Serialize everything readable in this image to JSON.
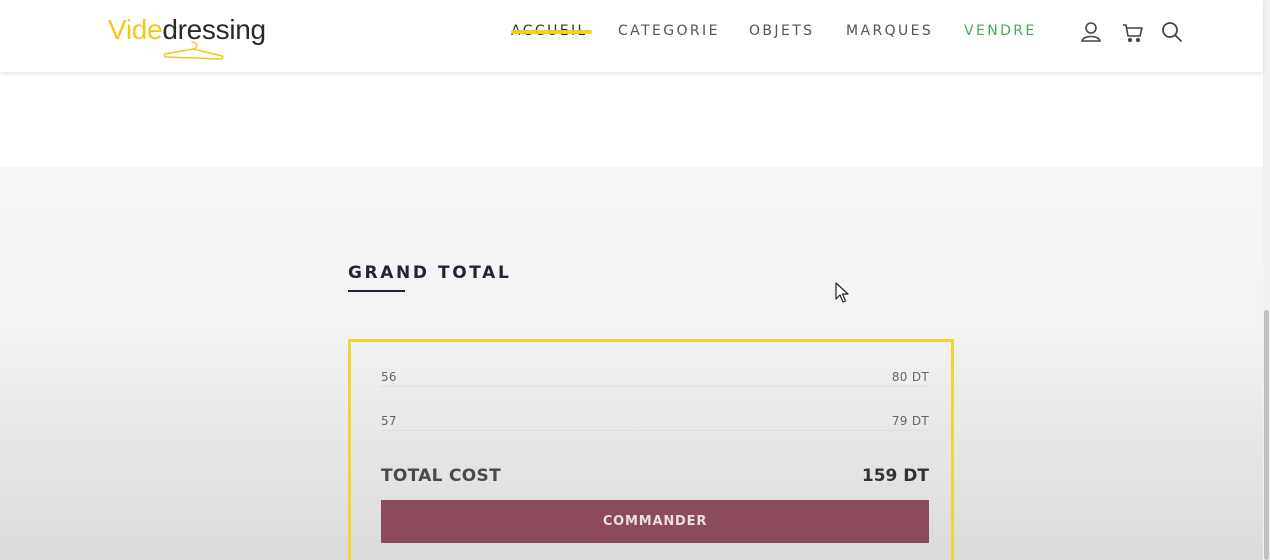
{
  "header": {
    "logo": {
      "part1": "Vide",
      "part2": "dressing"
    },
    "nav": [
      {
        "label": "ACCUEIL",
        "state": "active"
      },
      {
        "label": "CATEGORIE",
        "state": "default"
      },
      {
        "label": "OBJETS",
        "state": "default"
      },
      {
        "label": "MARQUES",
        "state": "default"
      },
      {
        "label": "VENDRE",
        "state": "highlight"
      }
    ],
    "icons": [
      "user-icon",
      "cart-icon",
      "search-icon"
    ]
  },
  "grand_total": {
    "title": "GRAND TOTAL",
    "items": [
      {
        "label": "56",
        "price": "80 DT"
      },
      {
        "label": "57",
        "price": "79 DT"
      }
    ],
    "total_label": "TOTAL COST",
    "total_value": "159 DT",
    "order_button": "COMMANDER"
  },
  "colors": {
    "accent_yellow": "#f4d23a",
    "sell_green": "#4aa85a",
    "button_bg": "#8c4b5b",
    "title_navy": "#1f2537"
  }
}
